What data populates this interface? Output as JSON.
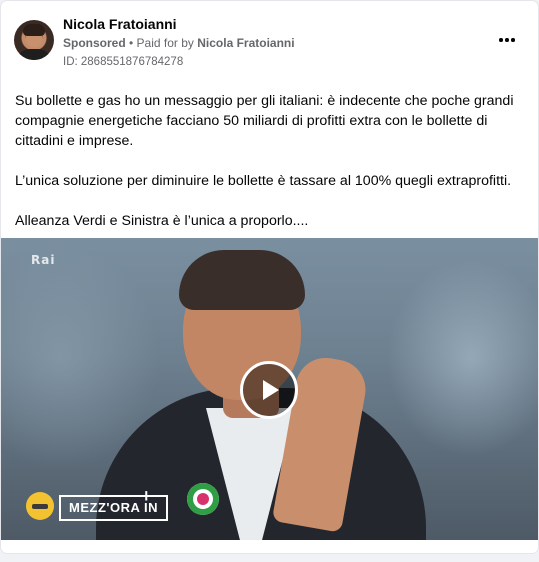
{
  "post": {
    "author_name": "Nicola Fratoianni",
    "sponsored_label": "Sponsored",
    "separator": " • ",
    "paid_for_prefix": "Paid for by ",
    "paid_for_by": "Nicola Fratoianni",
    "ad_id": "ID: 2868551876784278",
    "more_icon": "more-horizontal-icon",
    "paragraphs": [
      "Su bollette e gas ho un messaggio per gli italiani: è indecente che poche grandi compagnie energetiche facciano 50 miliardi di profitti extra con le bollette di cittadini e imprese.",
      "L’unica soluzione per diminuire le bollette è tassare al 100% quegli extraprofitti.",
      "Alleanza Verdi e Sinistra è l’unica a proporlo...."
    ]
  },
  "video": {
    "channel_logo": "rai",
    "show_title": "MEZZ'ORA IN",
    "show_plus": "+",
    "play_icon": "play-icon"
  }
}
